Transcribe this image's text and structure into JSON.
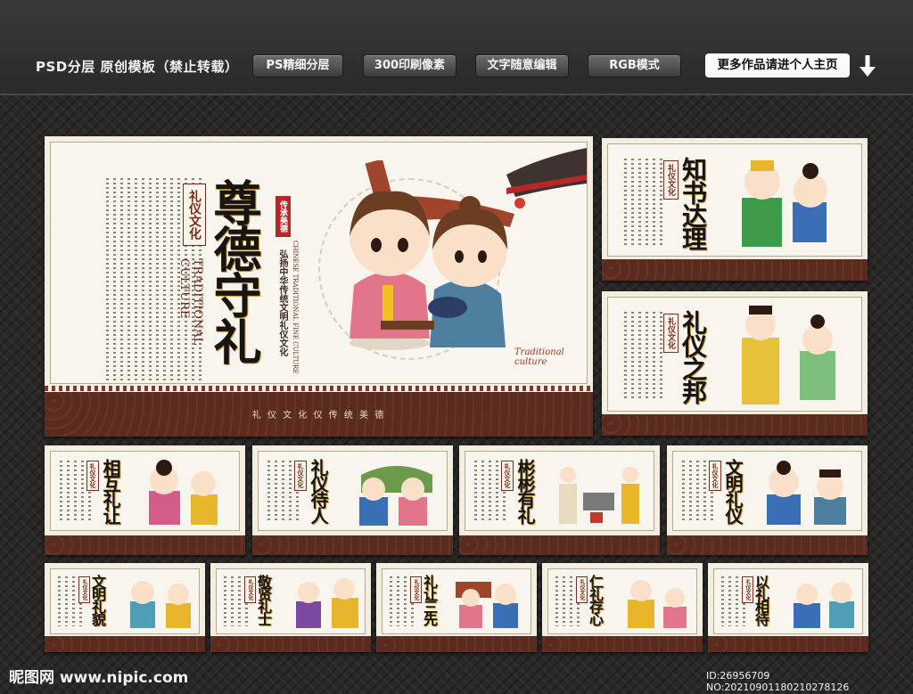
{
  "header": {
    "brand": "PSD分层 原创模板（禁止转载）",
    "badges": [
      "PS精细分层",
      "300印刷像素",
      "文字随意编辑",
      "RGB模式"
    ],
    "home_button": "更多作品请进个人主页",
    "arrow_icon": "arrow-down-icon"
  },
  "main_panel": {
    "title": "尊德守礼",
    "seal": "礼仪文化",
    "english": "TRADITIONAL CULTURE",
    "red_tag": "传承美德",
    "slogan_en": "CHINESE TRADITIONAL FINE CULTURE",
    "slogan_cn": "弘扬中华传统文明礼仪文化",
    "caption": "Traditional culture",
    "footer": "礼 仪 文 化  仪  传 统 美 德"
  },
  "side_panels": [
    {
      "title": "知书达理",
      "seal": "礼仪文化"
    },
    {
      "title": "礼仪之邦",
      "seal": "礼仪文化"
    }
  ],
  "row2_panels": [
    {
      "title": "相互礼让",
      "seal": "礼仪文化"
    },
    {
      "title": "礼仪待人",
      "seal": "礼仪文化"
    },
    {
      "title": "彬彬有礼",
      "seal": "礼仪文化"
    },
    {
      "title": "文明礼仪",
      "seal": "礼仪文化"
    }
  ],
  "row3_panels": [
    {
      "title": "文明礼貌",
      "seal": "礼仪文化"
    },
    {
      "title": "敬贤礼士",
      "seal": "礼仪文化"
    },
    {
      "title": "礼让三先",
      "seal": "礼仪文化"
    },
    {
      "title": "仁礼存心",
      "seal": "礼仪文化"
    },
    {
      "title": "以礼相待",
      "seal": "礼仪文化"
    }
  ],
  "watermark": {
    "site": "昵图网 www.nipic.com",
    "id": "ID:26956709 NO:20210901180210278126"
  },
  "colors": {
    "maroon": "#5c2b20",
    "gold": "#c79a3a",
    "paper": "#f8f5ee"
  }
}
